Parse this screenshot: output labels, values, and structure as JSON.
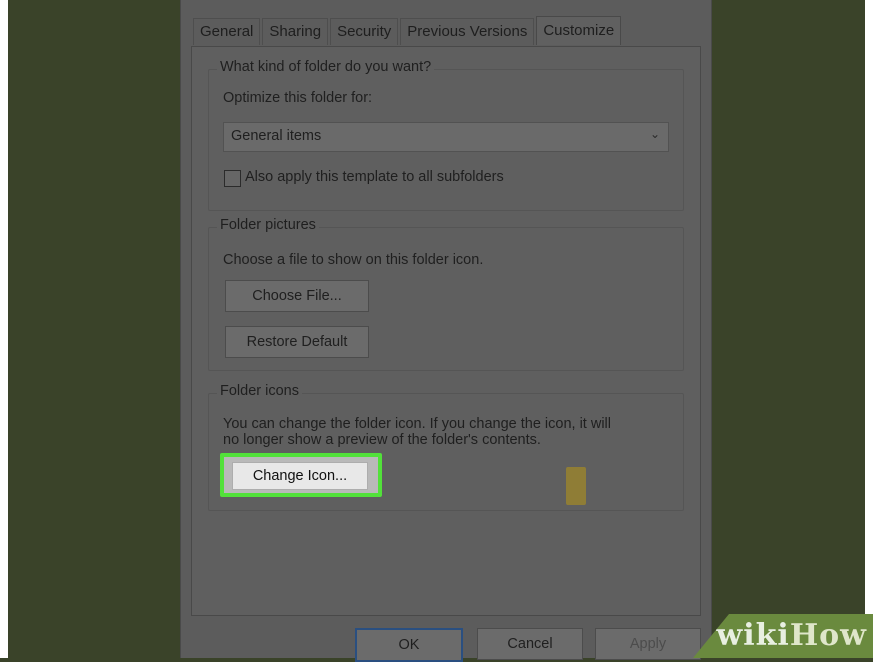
{
  "tabs": [
    "General",
    "Sharing",
    "Security",
    "Previous Versions",
    "Customize"
  ],
  "active_tab": "Customize",
  "folder_type": {
    "legend": "What kind of folder do you want?",
    "optimize_label": "Optimize this folder for:",
    "selected_option": "General items",
    "checkbox_label": "Also apply this template to all subfolders"
  },
  "folder_pictures": {
    "legend": "Folder pictures",
    "description": "Choose a file to show on this folder icon.",
    "choose_file": "Choose File...",
    "restore_default": "Restore Default"
  },
  "folder_icons": {
    "legend": "Folder icons",
    "description_line1": "You can change the folder icon. If you change the icon, it will",
    "description_line2": "no longer show a preview of the folder's contents.",
    "change_icon": "Change Icon..."
  },
  "footer": {
    "ok": "OK",
    "cancel": "Cancel",
    "apply": "Apply"
  },
  "branding": {
    "wiki": "wiki",
    "how": "How"
  },
  "colors": {
    "highlight": "#52e13a",
    "background": "#3a4329"
  }
}
